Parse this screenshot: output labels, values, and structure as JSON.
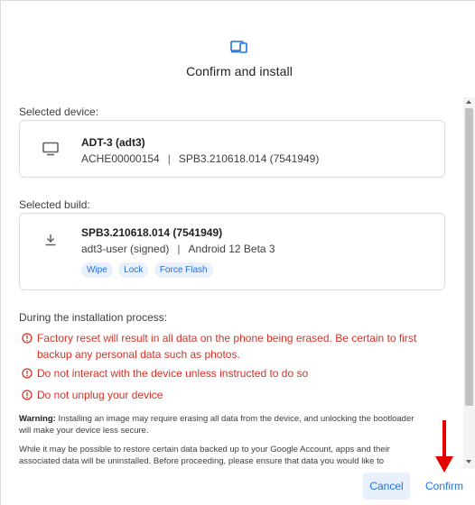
{
  "dialog": {
    "title": "Confirm and install"
  },
  "selected_device": {
    "label": "Selected device:",
    "name": "ADT-3 (adt3)",
    "serial": "ACHE00000154",
    "separator": "|",
    "build": "SPB3.210618.014 (7541949)"
  },
  "selected_build": {
    "label": "Selected build:",
    "id": "SPB3.210618.014 (7541949)",
    "variant": "adt3-user (signed)",
    "separator": "|",
    "version": "Android 12 Beta 3",
    "chips": [
      "Wipe",
      "Lock",
      "Force Flash"
    ]
  },
  "process": {
    "label": "During the installation process:",
    "warnings": [
      "Factory reset will result in all data on the phone being erased. Be certain to first backup any personal data such as photos.",
      "Do not interact with the device unless instructed to do so",
      "Do not unplug your device"
    ]
  },
  "notes": {
    "warning_label": "Warning:",
    "warning_text": " Installing an image may require erasing all data from the device, and unlocking the bootloader will make your device less secure.",
    "restore_text": "While it may be possible to restore certain data backed up to your Google Account, apps and their associated data will be uninstalled. Before proceeding, please ensure that data you would like to"
  },
  "buttons": {
    "cancel": "Cancel",
    "confirm": "Confirm"
  },
  "colors": {
    "accent": "#1a73e8",
    "error": "#d93025",
    "annotation_arrow": "#e50000"
  },
  "icons": {
    "header": "device-icon",
    "device_card": "monitor-icon",
    "build_card": "download-icon",
    "warning": "error-circle-icon"
  }
}
